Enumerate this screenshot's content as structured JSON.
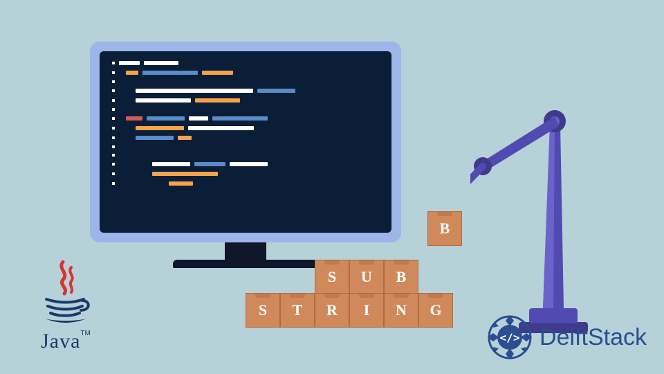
{
  "monitor": {
    "alt": "code-editor-illustration"
  },
  "boxes": {
    "top_row": [
      "S",
      "U",
      "B"
    ],
    "bottom_row": [
      "S",
      "T",
      "R",
      "I",
      "N",
      "G"
    ],
    "held": "B"
  },
  "java": {
    "text": "Java",
    "tm": "TM"
  },
  "delftstack": {
    "text": "DelftStack",
    "icon_glyph": "</>"
  },
  "colors": {
    "background": "#b7d1d9",
    "monitor_frame": "#9db5e8",
    "screen": "#0b1e38",
    "box": "#d0895b",
    "arm": "#514ab0",
    "java_red": "#d9322f",
    "java_blue": "#1a3a6a",
    "delft_blue": "#2a4e8f"
  }
}
